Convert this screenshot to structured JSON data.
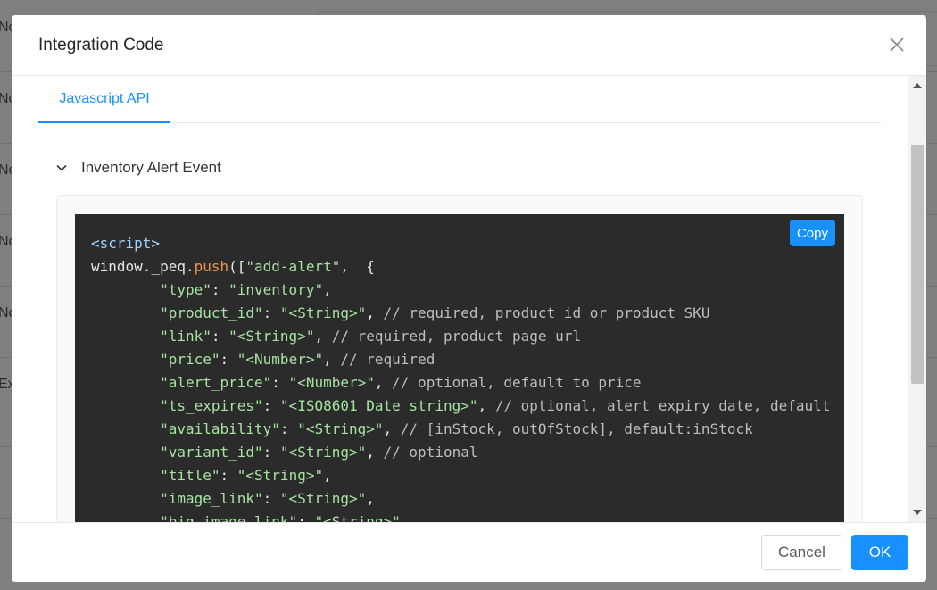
{
  "background": {
    "row_labels": [
      "Nc",
      "Nc",
      "Nc",
      "Nc",
      "Nc",
      "Ex"
    ]
  },
  "modal": {
    "title": "Integration Code",
    "close_icon": "close-icon",
    "tabs": [
      {
        "label": "Javascript API",
        "active": true
      }
    ],
    "panel": {
      "title": "Inventory Alert Event",
      "expanded": true,
      "arrow_icon": "chevron-down-icon"
    },
    "code": {
      "copy_label": "Copy",
      "lines": [
        [
          {
            "t": "tag",
            "v": "<script>"
          }
        ],
        [
          {
            "t": "plain",
            "v": "window._peq."
          },
          {
            "t": "fn",
            "v": "push"
          },
          {
            "t": "plain",
            "v": "(["
          },
          {
            "t": "str",
            "v": "\"add-alert\""
          },
          {
            "t": "plain",
            "v": ",  {"
          }
        ],
        [
          {
            "t": "plain",
            "v": "        "
          },
          {
            "t": "str",
            "v": "\"type\""
          },
          {
            "t": "plain",
            "v": ": "
          },
          {
            "t": "str",
            "v": "\"inventory\""
          },
          {
            "t": "plain",
            "v": ","
          }
        ],
        [
          {
            "t": "plain",
            "v": "        "
          },
          {
            "t": "str",
            "v": "\"product_id\""
          },
          {
            "t": "plain",
            "v": ": "
          },
          {
            "t": "str",
            "v": "\"<String>\""
          },
          {
            "t": "plain",
            "v": ", "
          },
          {
            "t": "com",
            "v": "// required, product id or product SKU"
          }
        ],
        [
          {
            "t": "plain",
            "v": "        "
          },
          {
            "t": "str",
            "v": "\"link\""
          },
          {
            "t": "plain",
            "v": ": "
          },
          {
            "t": "str",
            "v": "\"<String>\""
          },
          {
            "t": "plain",
            "v": ", "
          },
          {
            "t": "com",
            "v": "// required, product page url"
          }
        ],
        [
          {
            "t": "plain",
            "v": "        "
          },
          {
            "t": "str",
            "v": "\"price\""
          },
          {
            "t": "plain",
            "v": ": "
          },
          {
            "t": "str",
            "v": "\"<Number>\""
          },
          {
            "t": "plain",
            "v": ", "
          },
          {
            "t": "com",
            "v": "// required"
          }
        ],
        [
          {
            "t": "plain",
            "v": "        "
          },
          {
            "t": "str",
            "v": "\"alert_price\""
          },
          {
            "t": "plain",
            "v": ": "
          },
          {
            "t": "str",
            "v": "\"<Number>\""
          },
          {
            "t": "plain",
            "v": ", "
          },
          {
            "t": "com",
            "v": "// optional, default to price"
          }
        ],
        [
          {
            "t": "plain",
            "v": "        "
          },
          {
            "t": "str",
            "v": "\"ts_expires\""
          },
          {
            "t": "plain",
            "v": ": "
          },
          {
            "t": "str",
            "v": "\"<ISO8601 Date string>\""
          },
          {
            "t": "plain",
            "v": ", "
          },
          {
            "t": "com",
            "v": "// optional, alert expiry date, default"
          }
        ],
        [
          {
            "t": "plain",
            "v": "        "
          },
          {
            "t": "str",
            "v": "\"availability\""
          },
          {
            "t": "plain",
            "v": ": "
          },
          {
            "t": "str",
            "v": "\"<String>\""
          },
          {
            "t": "plain",
            "v": ", "
          },
          {
            "t": "com",
            "v": "// [inStock, outOfStock], default:inStock"
          }
        ],
        [
          {
            "t": "plain",
            "v": "        "
          },
          {
            "t": "str",
            "v": "\"variant_id\""
          },
          {
            "t": "plain",
            "v": ": "
          },
          {
            "t": "str",
            "v": "\"<String>\""
          },
          {
            "t": "plain",
            "v": ", "
          },
          {
            "t": "com",
            "v": "// optional"
          }
        ],
        [
          {
            "t": "plain",
            "v": "        "
          },
          {
            "t": "str",
            "v": "\"title\""
          },
          {
            "t": "plain",
            "v": ": "
          },
          {
            "t": "str",
            "v": "\"<String>\""
          },
          {
            "t": "plain",
            "v": ","
          }
        ],
        [
          {
            "t": "plain",
            "v": "        "
          },
          {
            "t": "str",
            "v": "\"image_link\""
          },
          {
            "t": "plain",
            "v": ": "
          },
          {
            "t": "str",
            "v": "\"<String>\""
          },
          {
            "t": "plain",
            "v": ","
          }
        ],
        [
          {
            "t": "plain",
            "v": "        "
          },
          {
            "t": "str",
            "v": "\"big_image_link\""
          },
          {
            "t": "plain",
            "v": ": "
          },
          {
            "t": "str",
            "v": "\"<String>\""
          },
          {
            "t": "plain",
            "v": ","
          }
        ]
      ]
    },
    "footer": {
      "cancel_label": "Cancel",
      "ok_label": "OK"
    },
    "colors": {
      "primary": "#1890ff",
      "code_bg": "#2b2b2b"
    }
  }
}
